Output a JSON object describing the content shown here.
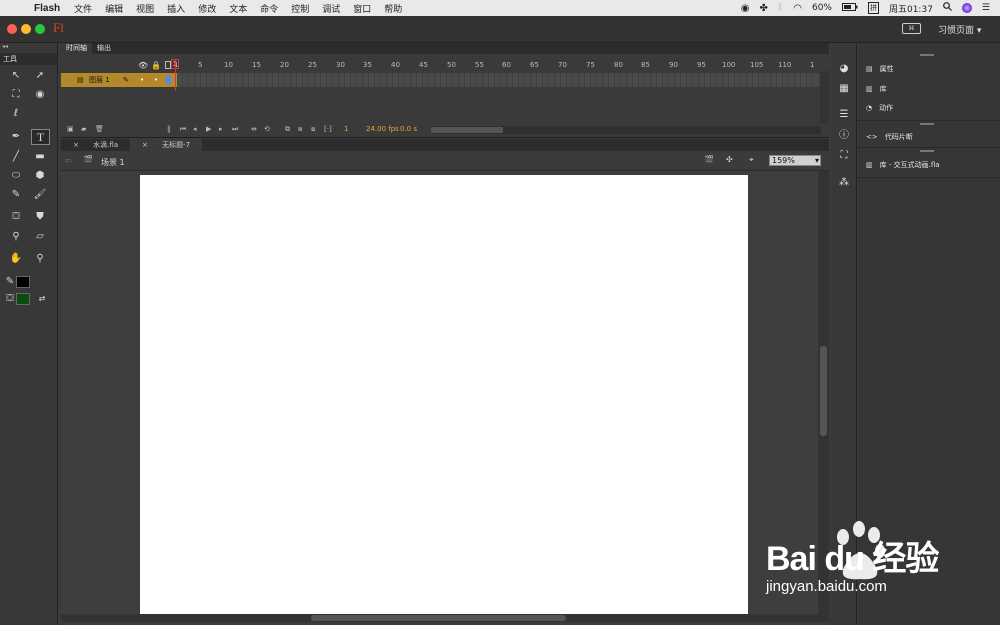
{
  "menubar": {
    "app_name": "Flash",
    "items": [
      "文件",
      "编辑",
      "视图",
      "插入",
      "修改",
      "文本",
      "命令",
      "控制",
      "调试",
      "窗口",
      "帮助"
    ],
    "battery": "60%",
    "input_method": "拼",
    "clock": "周五01:37"
  },
  "appbar": {
    "logo": "Fl",
    "workspace": "习惯页面"
  },
  "tools": {
    "header": "工具"
  },
  "timeline": {
    "tabs": [
      "时间轴",
      "输出"
    ],
    "layer_name": "图层 1",
    "ruler": [
      "1",
      "5",
      "10",
      "15",
      "20",
      "25",
      "30",
      "35",
      "40",
      "45",
      "50",
      "55",
      "60",
      "65",
      "70",
      "75",
      "80",
      "85",
      "90",
      "95",
      "100",
      "105",
      "110",
      "1"
    ],
    "current_frame": "1",
    "fps": "24.00 fps",
    "elapsed": "0.0 s"
  },
  "document_tabs": [
    "水滴.fla",
    "无标题-7"
  ],
  "stage": {
    "scene": "场景 1",
    "zoom": "159%"
  },
  "right_panel": {
    "items": [
      "属性",
      "库",
      "动作",
      "代码片断",
      "库 - 交互式动画.fla"
    ]
  },
  "watermark": {
    "brand": "Bai du 经验",
    "url": "jingyan.baidu.com"
  },
  "colors": {
    "accent": "#b4892a",
    "playhead": "#d33333",
    "fill_color": "#0b4a10",
    "stroke_color": "#000000"
  }
}
